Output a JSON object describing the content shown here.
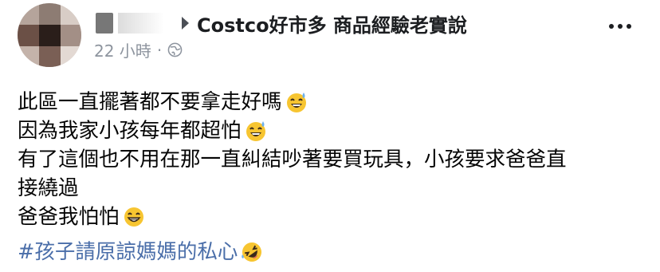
{
  "header": {
    "group_name": "Costco好市多 商品經驗老實說",
    "time": "22 小時",
    "separator": "·",
    "privacy_icon": "globe-icon",
    "more_icon": "more-options-icon"
  },
  "post": {
    "lines": [
      "此區一直擺著都不要拿走好嗎",
      "因為我家小孩每年都超怕",
      "有了這個也不用在那一直糾結吵著要買玩具，小孩要求爸爸直",
      "接繞過",
      "爸爸我怕怕"
    ],
    "hashtag": "#孩子請原諒媽媽的私心"
  },
  "colors": {
    "hashtag": "#4a6ea9",
    "meta": "#8d949e",
    "emoji_yellow": "#f7c531"
  }
}
